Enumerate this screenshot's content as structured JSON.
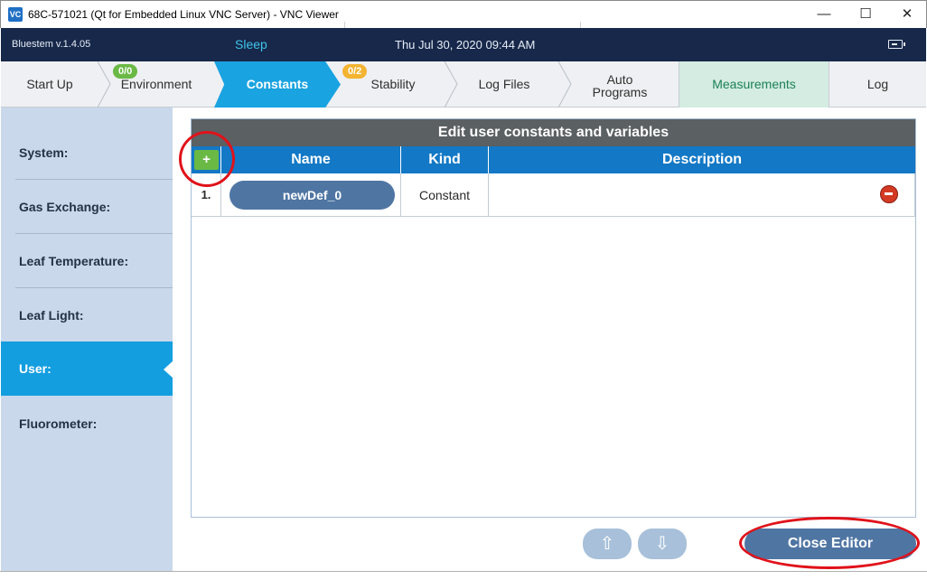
{
  "window": {
    "app_icon_text": "VC",
    "title": "68C-571021 (Qt for Embedded Linux VNC Server) - VNC Viewer",
    "minimize_glyph": "—",
    "maximize_glyph": "☐",
    "close_glyph": "✕"
  },
  "header": {
    "version": "Bluestem v.1.4.05",
    "state": "Sleep",
    "datetime": "Thu Jul 30, 2020 09:44 AM",
    "icon": "battery-icon"
  },
  "tabs": [
    {
      "label": "Start Up"
    },
    {
      "label": "Environment",
      "badge": "0/0"
    },
    {
      "label": "Constants"
    },
    {
      "label": "Stability",
      "badge": "0/2"
    },
    {
      "label": "Log Files"
    },
    {
      "label": "Auto",
      "label2": "Programs"
    },
    {
      "label": "Measurements"
    },
    {
      "label": "Log"
    }
  ],
  "sidebar": {
    "items": [
      {
        "label": "System:"
      },
      {
        "label": "Gas Exchange:"
      },
      {
        "label": "Leaf Temperature:"
      },
      {
        "label": "Leaf Light:"
      },
      {
        "label": "User:"
      },
      {
        "label": "Fluorometer:"
      }
    ],
    "active": "User:"
  },
  "editor": {
    "title": "Edit user constants and variables",
    "add_glyph": "+",
    "columns": {
      "name": "Name",
      "kind": "Kind",
      "description": "Description"
    },
    "rows": [
      {
        "num": "1.",
        "name": "newDef_0",
        "kind": "Constant",
        "description": ""
      }
    ]
  },
  "footer": {
    "up_glyph": "⇧",
    "down_glyph": "⇩",
    "close_label": "Close Editor"
  },
  "colors": {
    "accent": "#1aa3e1",
    "header_bg": "#17284a",
    "add_green": "#6ab945",
    "remove_red": "#d33a24",
    "annotation_red": "#e0121a"
  }
}
